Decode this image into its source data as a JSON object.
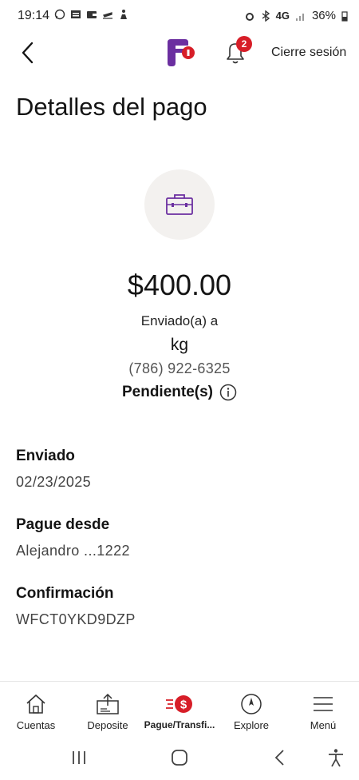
{
  "status_bar": {
    "time": "19:14",
    "network": "4G",
    "battery": "36%"
  },
  "header": {
    "logout_label": "Cierre sesión",
    "notification_count": "2"
  },
  "page": {
    "title": "Detalles del pago"
  },
  "payment": {
    "icon": "briefcase-icon",
    "amount": "$400.00",
    "sent_to_label": "Enviado(a) a",
    "recipient": "kg",
    "phone": "(786) 922-6325",
    "status": "Pendiente(s)"
  },
  "details": [
    {
      "label": "Enviado",
      "value": "02/23/2025"
    },
    {
      "label": "Pague desde",
      "value": "Alejandro ...1222"
    },
    {
      "label": "Confirmación",
      "value": "WFCT0YKD9DZP"
    }
  ],
  "bottom_nav": [
    {
      "label": "Cuentas",
      "icon": "home-icon"
    },
    {
      "label": "Deposite",
      "icon": "deposit-icon"
    },
    {
      "label": "Pague/Transfi...",
      "icon": "pay-transfer-icon"
    },
    {
      "label": "Explore",
      "icon": "compass-icon"
    },
    {
      "label": "Menú",
      "icon": "menu-icon"
    }
  ],
  "colors": {
    "accent_purple": "#6b2fa0",
    "brand_red": "#d71e28",
    "icon_circle_bg": "#f3f1ef"
  }
}
